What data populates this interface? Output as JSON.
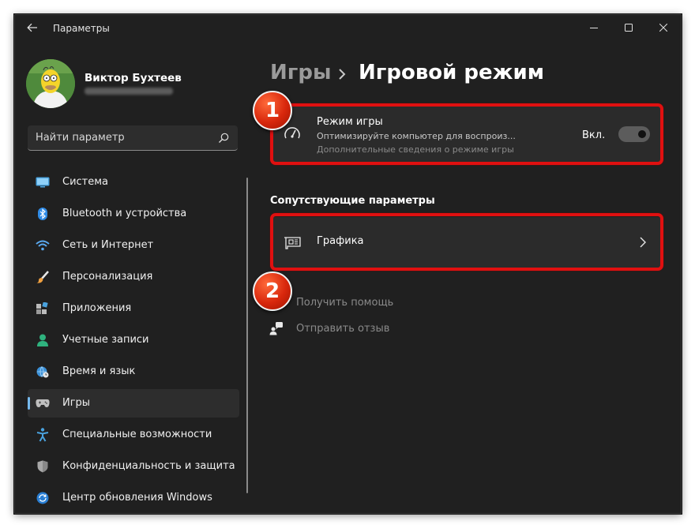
{
  "window": {
    "title": "Параметры"
  },
  "user": {
    "name": "Виктор Бухтеев"
  },
  "search": {
    "placeholder": "Найти параметр"
  },
  "sidebar": {
    "items": [
      {
        "label": "Система",
        "icon": "monitor-icon"
      },
      {
        "label": "Bluetooth и устройства",
        "icon": "bluetooth-icon"
      },
      {
        "label": "Сеть и Интернет",
        "icon": "wifi-icon"
      },
      {
        "label": "Персонализация",
        "icon": "brush-icon"
      },
      {
        "label": "Приложения",
        "icon": "apps-icon"
      },
      {
        "label": "Учетные записи",
        "icon": "person-icon"
      },
      {
        "label": "Время и язык",
        "icon": "globe-clock-icon"
      },
      {
        "label": "Игры",
        "icon": "gamepad-icon",
        "selected": true
      },
      {
        "label": "Специальные возможности",
        "icon": "accessibility-icon"
      },
      {
        "label": "Конфиденциальность и защита",
        "icon": "shield-icon"
      },
      {
        "label": "Центр обновления Windows",
        "icon": "update-icon"
      }
    ]
  },
  "breadcrumb": {
    "parent": "Игры",
    "current": "Игровой режим"
  },
  "game_mode": {
    "title": "Режим игры",
    "description": "Оптимизируйте компьютер для воспроиз...",
    "link": "Дополнительные сведения о режиме игры",
    "toggle_label": "Вкл.",
    "enabled": true
  },
  "related": {
    "heading": "Сопутствующие параметры",
    "graphics_label": "Графика"
  },
  "help": {
    "get_help": "Получить помощь",
    "feedback": "Отправить отзыв"
  },
  "annotations": {
    "badge1": "1",
    "badge2": "2"
  },
  "colors": {
    "window_bg": "#202020",
    "card_bg": "#2b2b2b",
    "accent": "#76b9ed",
    "annotation_red": "#e01010"
  }
}
